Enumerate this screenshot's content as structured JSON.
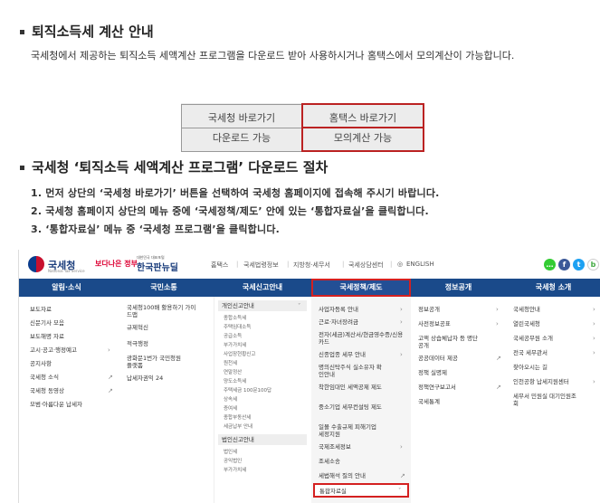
{
  "section1": {
    "title": "퇴직소득세 계산 안내",
    "desc": "국세청에서 제공하는 퇴직소득 세액계산 프로그램을 다운로드 받아 사용하시거나 홈택스에서 모의계산이 가능합니다.",
    "table": [
      [
        "국세청 바로가기",
        "홈택스 바로가기"
      ],
      [
        "다운로드 가능",
        "모의계산 가능"
      ]
    ]
  },
  "section2": {
    "title": "국세청 ‘퇴직소득 세액계산 프로그램’ 다운로드 절차",
    "steps": [
      "1. 먼저 상단의 ‘국세청 바로가기’ 버튼을 선택하여 국세청 홈페이지에 접속해 주시기 바랍니다.",
      "2. 국세청 홈페이지 상단의 메뉴 중에 ‘국세정책/제도’ 안에 있는 ‘통합자료실’을 클릭합니다.",
      "3. ‘통합자료실’ 메뉴 중 ‘국세청 프로그램’을 클릭합니다."
    ]
  },
  "shot": {
    "logo": {
      "name": "국세청",
      "sub": "National Tax Service",
      "slogan": "보다나은 정부",
      "brand_small": "대한민국 대표포털",
      "brand": "한국판뉴딜"
    },
    "util": [
      "홈택스",
      "국세법령정보",
      "지방청·세무서",
      "국세상담센터",
      "ENGLISH"
    ],
    "nav": [
      "알림·소식",
      "국민소통",
      "국세신고안내",
      "국세정책/제도",
      "정보공개",
      "국세청 소개"
    ],
    "col1": [
      "보도자료",
      "신문기사 모음",
      "보도해명 자료",
      "고시·공고·행정예고",
      "공지사항",
      "국세청 소식",
      "국세청 동영상",
      "모범·아름다운 납세자"
    ],
    "col2": [
      "국세청100배 활용하기 가이드맵",
      "규제혁신",
      "적극행정",
      "광화문1번가 국민청원플랫폼",
      "납세자권익 24"
    ],
    "col3_head": "개인신고안내",
    "col3": [
      "종합소득세",
      "주택임대소득",
      "공급소득",
      "부가가치세",
      "사업장현황신고",
      "원천세",
      "연말정산",
      "양도소득세",
      "주택세금 100문100답",
      "상속세",
      "증여세",
      "종합부동산세",
      "세금납부 안내"
    ],
    "col3_head2": "법인신고안내",
    "col3b": [
      "법인세",
      "공익법인",
      "부가가치세"
    ],
    "col4": [
      "사업자등록 안내",
      "근로·자녀장려금",
      "전자(세금)계산서/현금영수증/신용카드",
      "신종업종 세무 안내",
      "명의신탁주식 실소유자 확인안내",
      "착한임대인 세액공제 제도",
      "중소기업 세무컨설팅 제도",
      "일몰 수출규제 피해기업 세정지원",
      "국제조세정보",
      "조세소송",
      "세법해석 질의 안내"
    ],
    "col4_hl": "통합자료실",
    "col5": [
      "정보공개",
      "사전정보공표",
      "고액 상습체납자 등 명단 공개",
      "공공데이터 제공",
      "정책 실명제",
      "정책연구보고서",
      "국세통계"
    ],
    "col6": [
      "국세청안내",
      "열린국세청",
      "국세공무원 소개",
      "전국 세무관서",
      "찾아오시는 길",
      "인천공항 납세지원센터",
      "세무서 민원실 대기인원조회"
    ]
  }
}
